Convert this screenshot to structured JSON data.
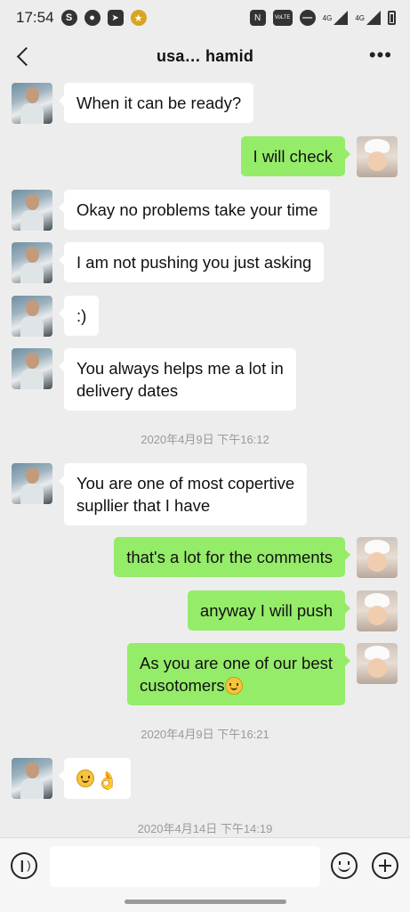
{
  "status_bar": {
    "time": "17:54",
    "icons": [
      "skype-icon",
      "message-icon",
      "navigation-icon",
      "app-icon"
    ],
    "right_icons": [
      "nfc-icon",
      "volte-icon",
      "dnd-icon",
      "signal-4g-icon",
      "signal-4g-icon",
      "battery-icon"
    ],
    "nfc": "N",
    "volte": "VoLTE",
    "net1": "4G",
    "net2": "4G"
  },
  "header": {
    "title": "usa… hamid",
    "more_label": "•••"
  },
  "messages": [
    {
      "from": "them",
      "text": "When it can be ready?"
    },
    {
      "from": "me",
      "text": "I will check"
    },
    {
      "from": "them",
      "text": "Okay no problems take your time"
    },
    {
      "from": "them",
      "text": "I am not pushing you just asking"
    },
    {
      "from": "them",
      "text": ":)"
    },
    {
      "from": "them",
      "text_line1": "You always helps me a lot in",
      "text_line2": "delivery dates"
    },
    {
      "timestamp": "2020年4月9日 下午16:12"
    },
    {
      "from": "them",
      "text_line1": "You are one of most copertive",
      "text_line2": "supllier that I have"
    },
    {
      "from": "me",
      "text": "that's a lot for the comments"
    },
    {
      "from": "me",
      "text": "anyway I will push"
    },
    {
      "from": "me",
      "text_line1": "As you are one of our best",
      "text_line2": "cusotomers"
    },
    {
      "timestamp": "2020年4月9日 下午16:21"
    },
    {
      "from": "them",
      "emoji": [
        "smiling-face-emoji",
        "ok-hand-emoji"
      ],
      "hand_glyph": "👌"
    },
    {
      "timestamp": "2020年4月14日 下午14:19"
    }
  ],
  "input_bar": {
    "placeholder": "",
    "icons": [
      "voice-icon",
      "emoji-icon",
      "add-icon"
    ],
    "voice_glyph": "❙)"
  },
  "colors": {
    "background": "#ededed",
    "incoming_bubble": "#ffffff",
    "outgoing_bubble": "#95ec69",
    "timestamp_text": "#9a9a9a"
  }
}
